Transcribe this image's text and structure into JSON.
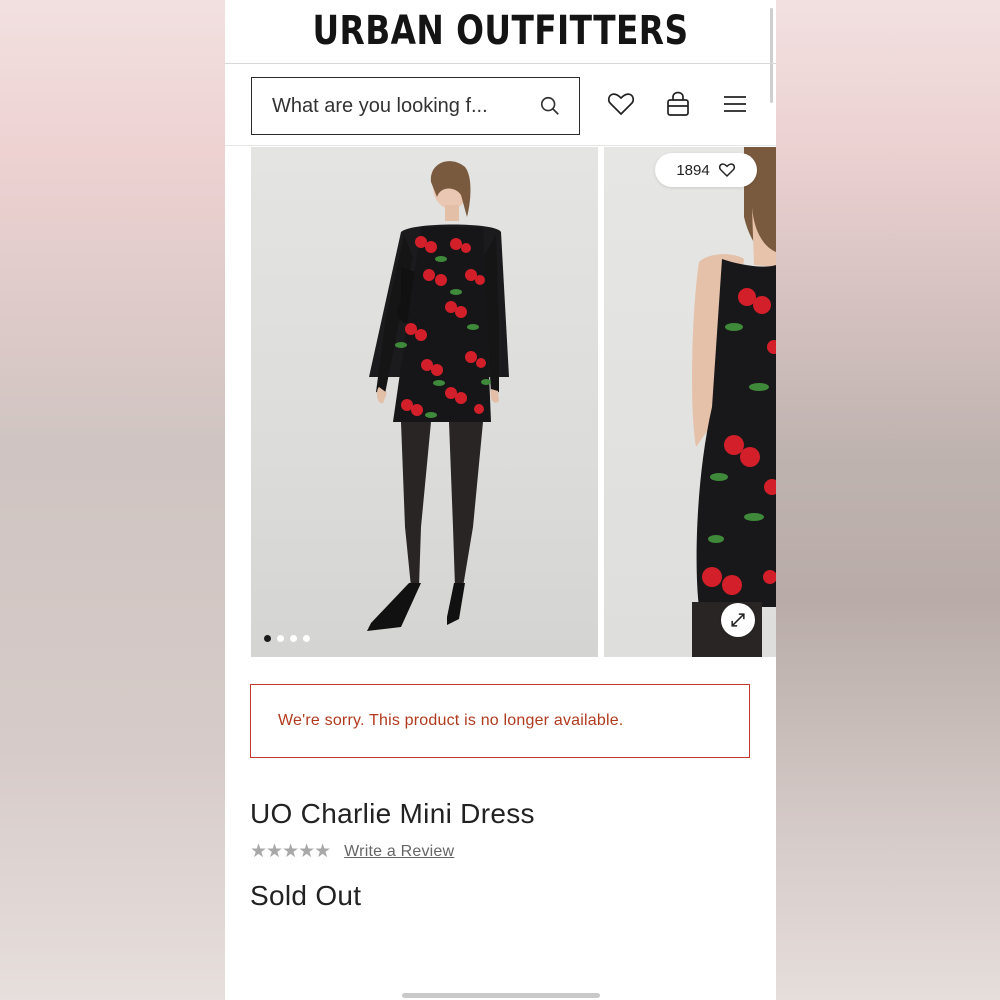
{
  "brand": {
    "name": "URBAN OUTFITTERS"
  },
  "search": {
    "placeholder": "What are you looking f..."
  },
  "icons": {
    "search": "search-icon",
    "wishlist": "heart-icon",
    "bag": "shopping-bag-icon",
    "menu": "hamburger-menu-icon",
    "expand": "expand-icon"
  },
  "gallery": {
    "like_count": "1894",
    "slide_count": 4,
    "active_slide": 1
  },
  "alert": {
    "message": "We're sorry. This product is no longer available.",
    "color": "#c0392b"
  },
  "product": {
    "title": "UO Charlie Mini Dress",
    "stars": "★★★★★",
    "rating_value": 0,
    "review_link": "Write a Review",
    "status": "Sold Out"
  }
}
